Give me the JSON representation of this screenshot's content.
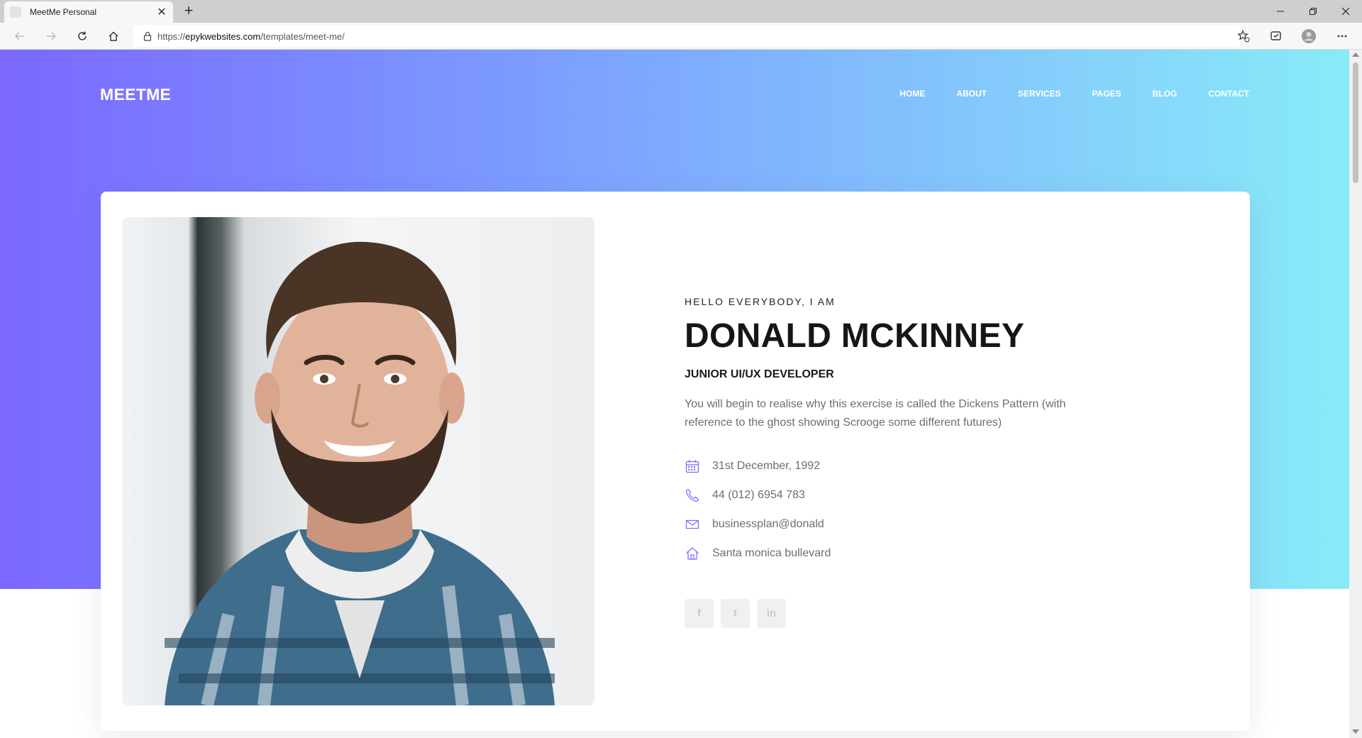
{
  "browser": {
    "tab_title": "MeetMe Personal",
    "url_prefix": "https://",
    "url_domain": "epykwebsites.com",
    "url_path": "/templates/meet-me/"
  },
  "site": {
    "logo": "MEETME",
    "nav": [
      "HOME",
      "ABOUT",
      "SERVICES",
      "PAGES",
      "BLOG",
      "CONTACT"
    ]
  },
  "profile": {
    "intro": "HELLO EVERYBODY, I AM",
    "name": "DONALD MCKINNEY",
    "role": "JUNIOR UI/UX DEVELOPER",
    "bio": "You will begin to realise why this exercise is called the Dickens Pattern (with reference to the ghost showing Scrooge some different futures)",
    "contacts": [
      {
        "icon": "calendar-icon",
        "text": "31st December, 1992"
      },
      {
        "icon": "phone-icon",
        "text": "44 (012) 6954 783"
      },
      {
        "icon": "envelope-icon",
        "text": "businessplan@donald"
      },
      {
        "icon": "home-icon",
        "text": "Santa monica bullevard"
      }
    ],
    "social": [
      {
        "icon": "facebook-icon",
        "glyph": "f"
      },
      {
        "icon": "twitter-icon",
        "glyph": "t"
      },
      {
        "icon": "linkedin-icon",
        "glyph": "in"
      }
    ]
  },
  "colors": {
    "gradient_start": "#7b68ff",
    "gradient_end": "#88ebf8",
    "icon_accent": "#7b68ff"
  }
}
